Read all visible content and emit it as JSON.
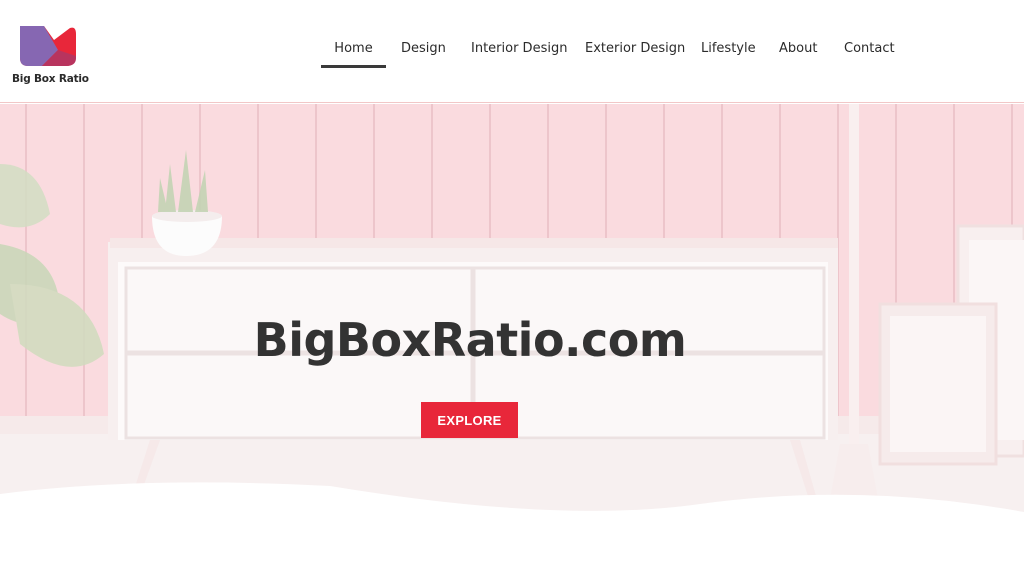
{
  "site": {
    "logo_text": "Big Box Ratio",
    "colors": {
      "brand_red": "#e8273a",
      "brand_purple": "#7b6fc0",
      "text_dark": "#333333"
    }
  },
  "nav": {
    "items": [
      {
        "label": "Home",
        "active": true
      },
      {
        "label": "Design"
      },
      {
        "label": "Interior Design"
      },
      {
        "label": "Exterior Design"
      },
      {
        "label": "Lifestyle"
      },
      {
        "label": "About"
      },
      {
        "label": "Contact"
      }
    ]
  },
  "hero": {
    "title": "BigBoxRatio.com",
    "button_label": "EXPLORE"
  }
}
